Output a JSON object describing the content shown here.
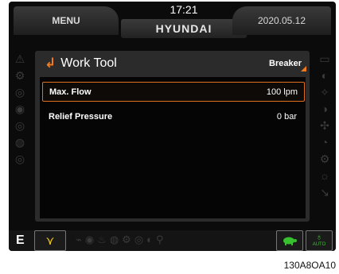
{
  "top_bar": {
    "menu_label": "MENU",
    "time": "17:21",
    "signal_icon": "signal-bars-icon",
    "brand": "HYUNDAI",
    "date": "2020.05.12"
  },
  "panel": {
    "title": "Work Tool",
    "back_icon": "return-arrow-icon",
    "mode_label": "Breaker",
    "rows": [
      {
        "label": "Max. Flow",
        "value": "100 lpm",
        "selected": true
      },
      {
        "label": "Relief Pressure",
        "value": "0 bar",
        "selected": false
      }
    ]
  },
  "bottom_bar": {
    "mode_letter": "E",
    "work_tool_icon": "work-tool-icon",
    "speed_icon": "turtle-icon",
    "auto_label": "AUTO",
    "auto_icon": "auto-idle-icon"
  },
  "caption": "130A8OA10",
  "colors": {
    "accent": "#f07a1e",
    "background": "#0b0b0b",
    "panel": "#2b2b2b",
    "green": "#38c12e"
  }
}
